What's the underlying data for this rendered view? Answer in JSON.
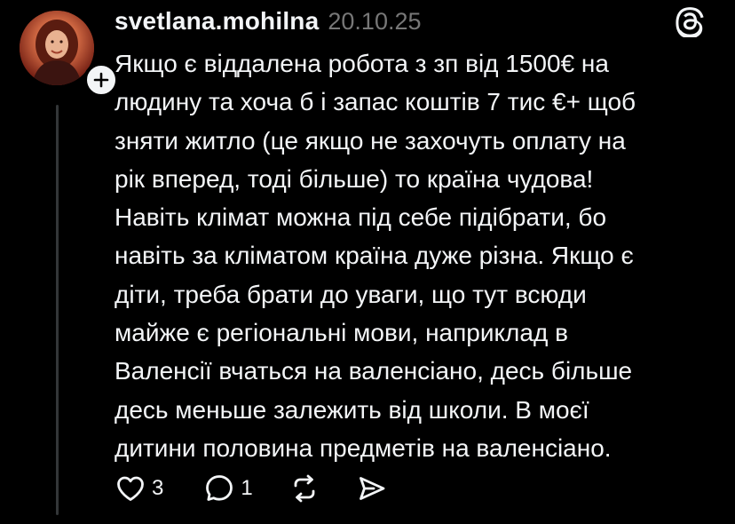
{
  "post": {
    "username": "svetlana.mohilna",
    "date": "20.10.25",
    "text_lines": [
      "Якщо є віддалена робота з зп від 1500€ на",
      "людину та  хоча б і запас коштів 7 тис €+ щоб",
      "зняти житло (це якщо не захочуть оплату на",
      "рік вперед, тоді більше) то країна чудова!",
      "Навіть клімат можна під себе підібрати, бо",
      "навіть за кліматом країна дуже різна. Якщо є",
      "діти, треба брати до уваги, що тут всюди",
      "майже є регіональні мови, наприклад в",
      "Валенсії вчаться на валенсіано, десь більше",
      "десь меньше залежить від школи. В моєї",
      "дитини половина предметів на валенсіано."
    ],
    "likes": "3",
    "replies": "1"
  },
  "icons": {
    "avatar": "avatar",
    "follow": "plus-icon",
    "logo": "threads-logo-icon",
    "like": "heart-icon",
    "reply": "comment-bubble-icon",
    "repost": "repost-icon",
    "share": "send-icon"
  },
  "colors": {
    "background": "#000000",
    "text": "#f3f5f7",
    "muted": "#777777",
    "thread_line": "#333638"
  }
}
